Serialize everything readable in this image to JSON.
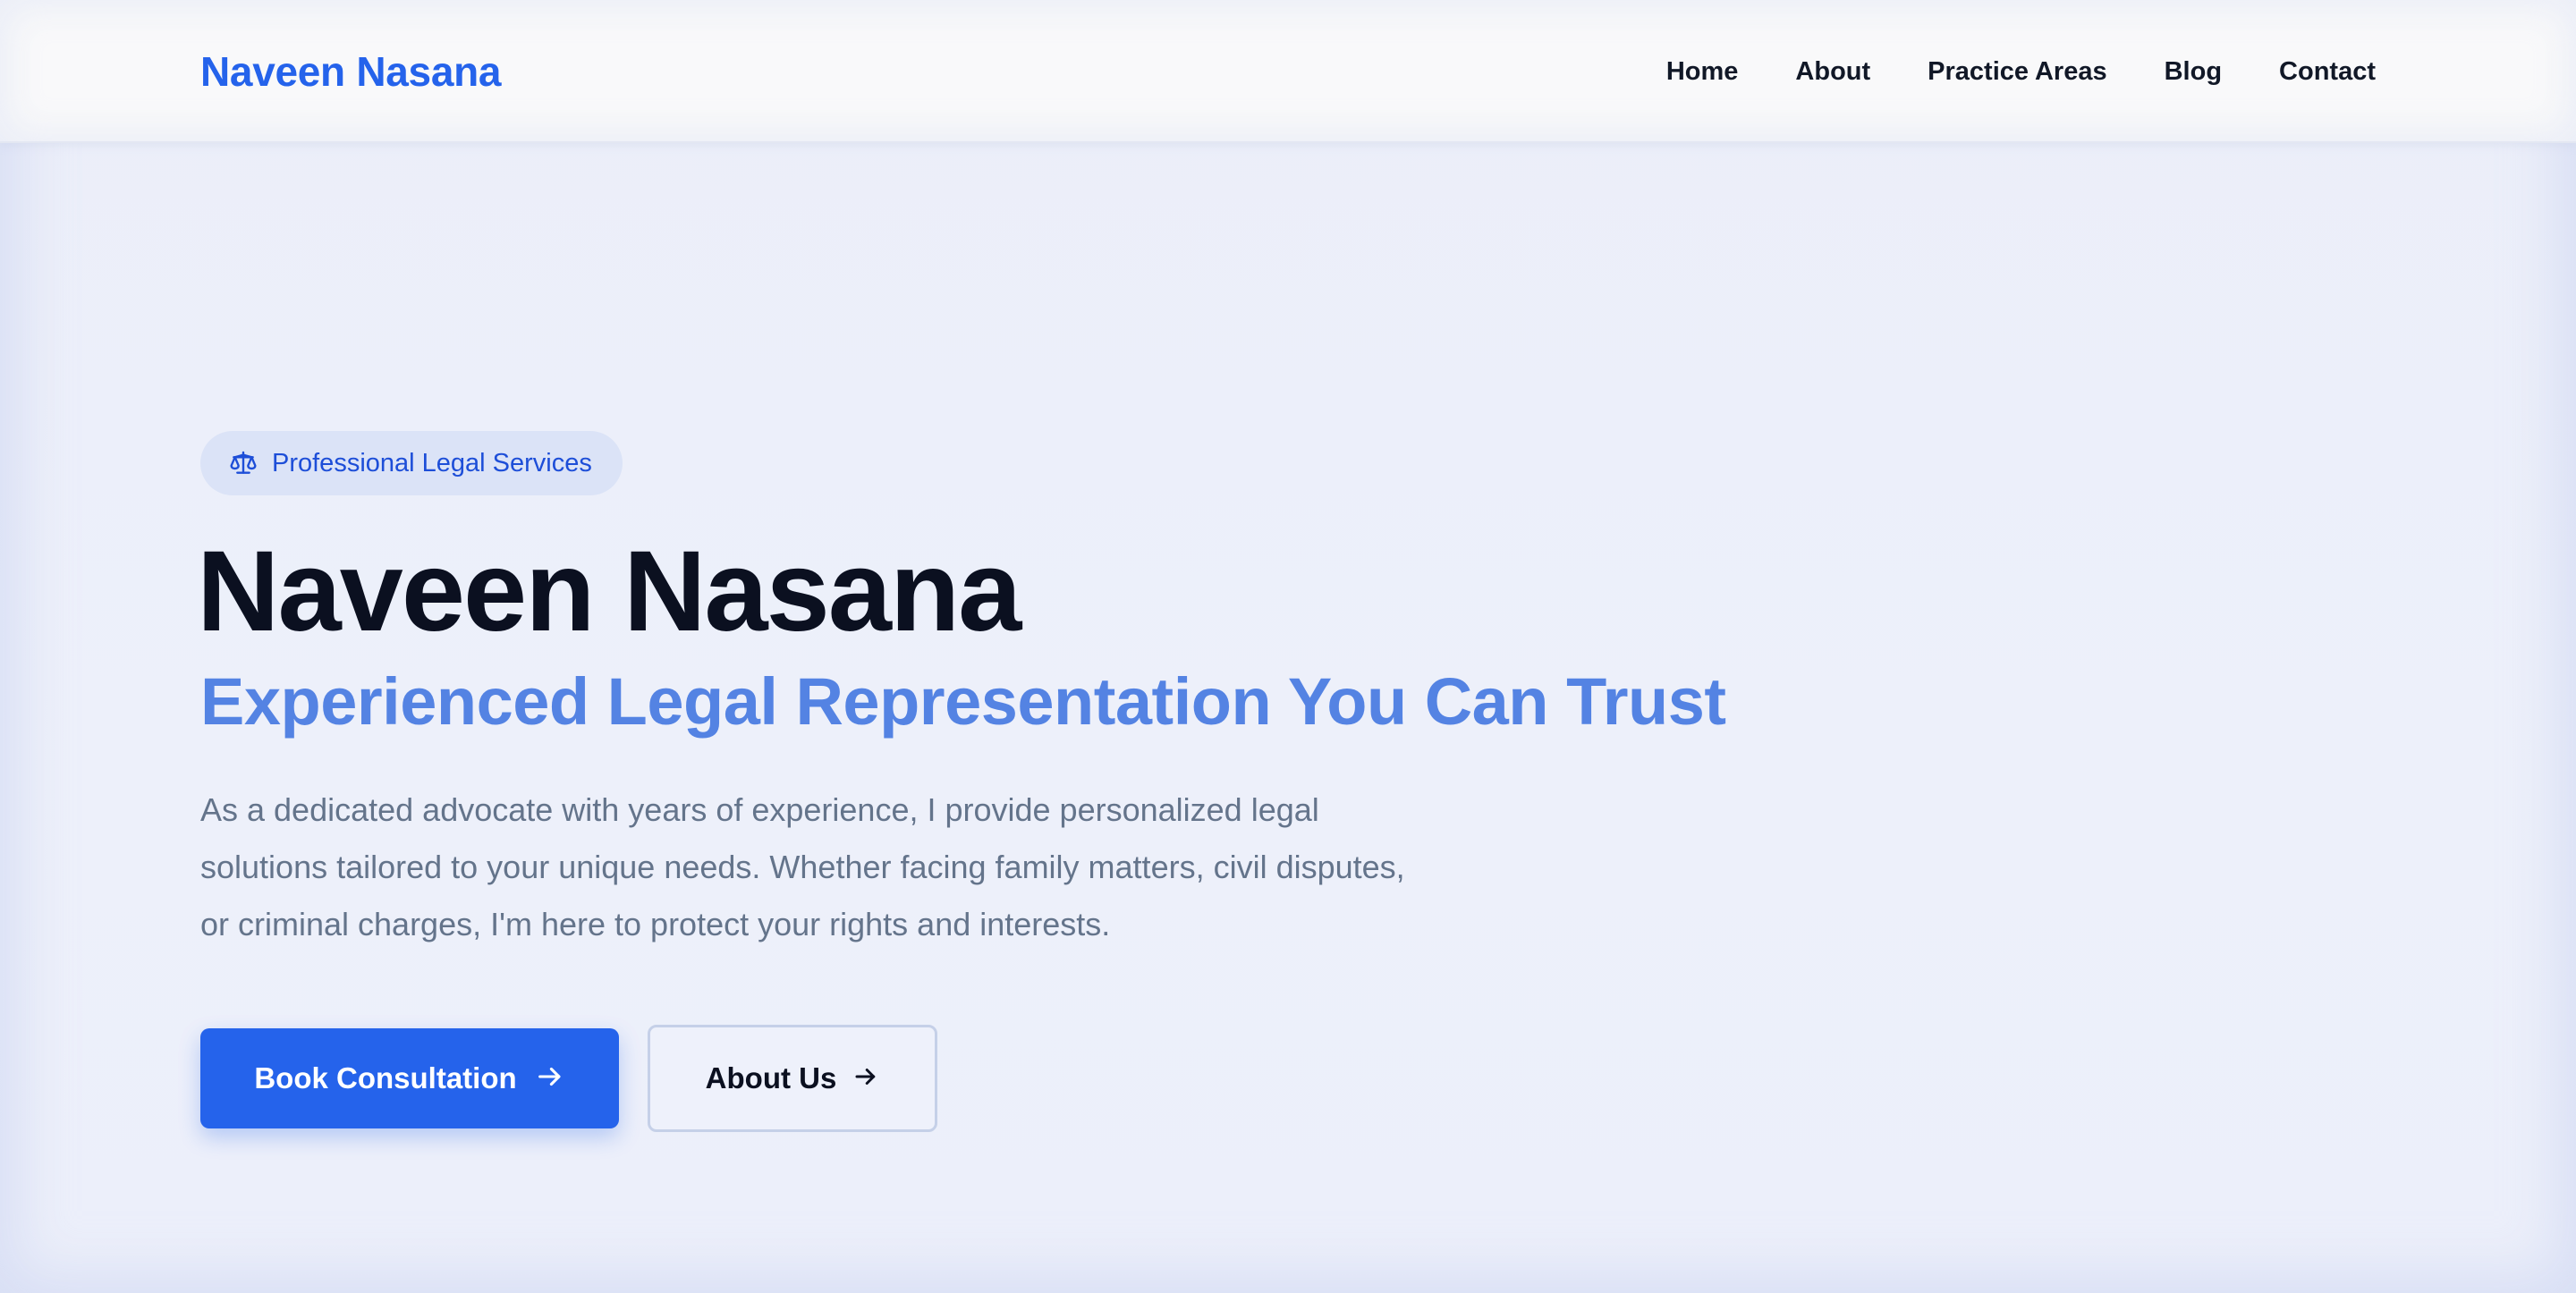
{
  "header": {
    "logo": "Naveen Nasana",
    "nav": [
      "Home",
      "About",
      "Practice Areas",
      "Blog",
      "Contact"
    ]
  },
  "hero": {
    "badge": {
      "icon": "scales-icon",
      "label": "Professional Legal Services"
    },
    "title": "Naveen Nasana",
    "subtitle": "Experienced Legal Representation You Can Trust",
    "description": "As a dedicated advocate with years of experience, I provide personalized legal solutions tailored to your unique needs. Whether facing family matters, civil disputes, or criminal charges, I'm here to protect your rights and interests.",
    "primary_button": {
      "label": "Book Consultation",
      "icon": "arrow-right-icon"
    },
    "secondary_button": {
      "label": "About Us",
      "icon": "arrow-right-icon"
    }
  },
  "colors": {
    "accent": "#2563eb",
    "subtitle": "#5483e3",
    "heading": "#0b1020",
    "body_text": "#64748b",
    "background": "#ebeef9"
  }
}
